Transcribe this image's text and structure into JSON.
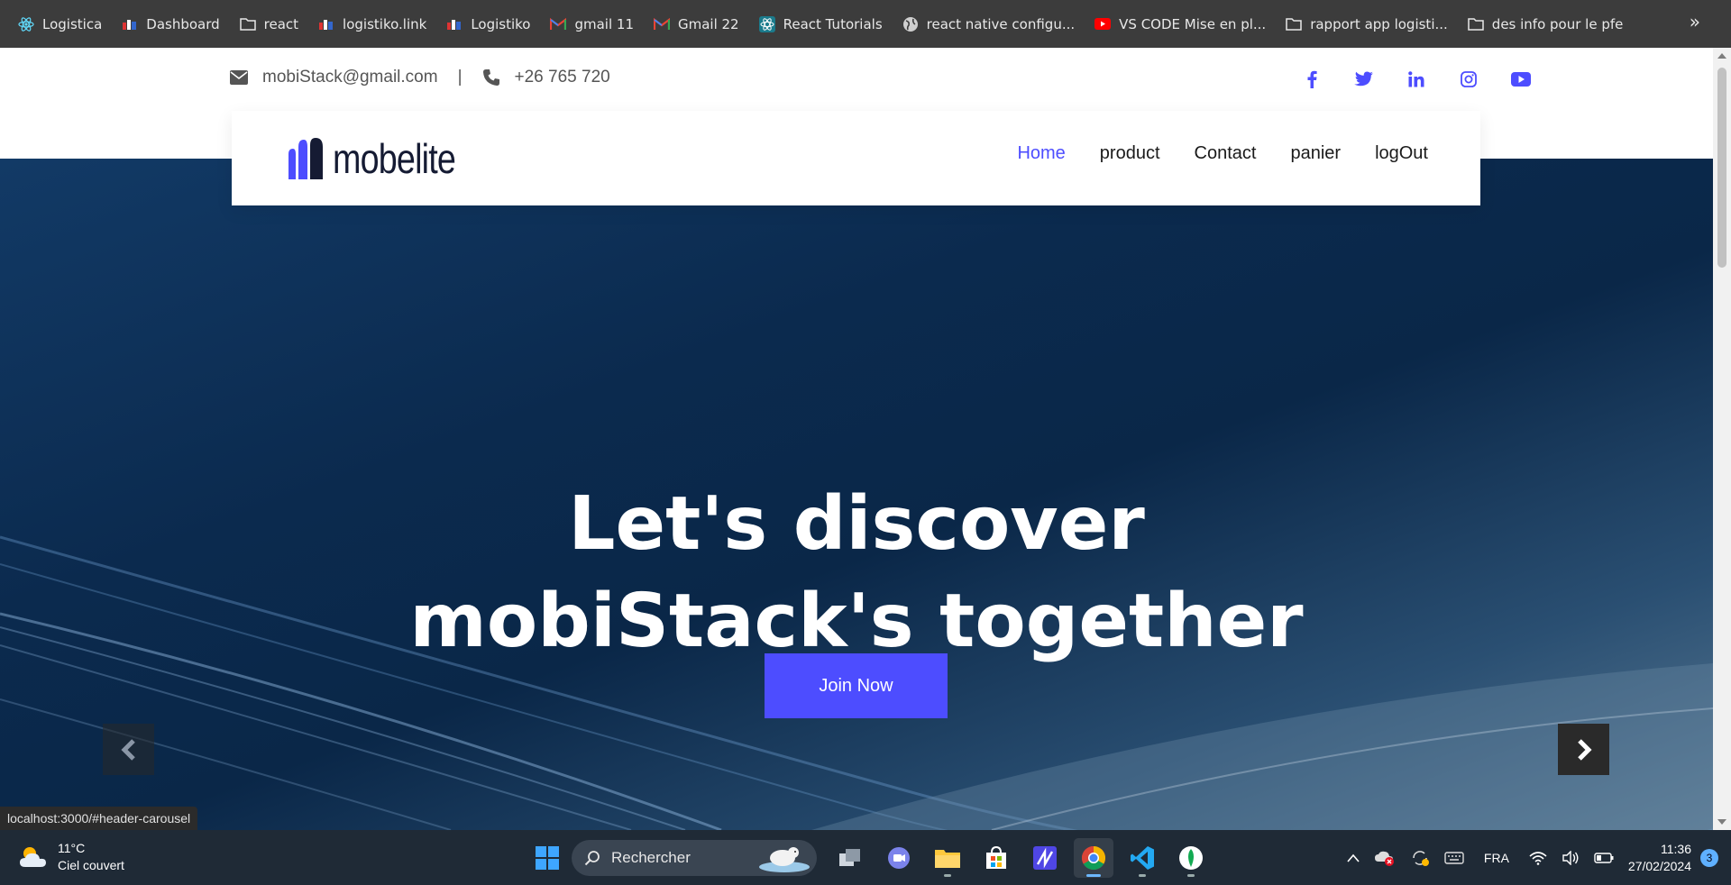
{
  "bookmarks": [
    {
      "label": "Logistica",
      "icon": "react-icon"
    },
    {
      "label": "Dashboard",
      "icon": "site-icon"
    },
    {
      "label": "react",
      "icon": "folder-icon"
    },
    {
      "label": "logistiko.link",
      "icon": "site-icon"
    },
    {
      "label": "Logistiko",
      "icon": "site-icon"
    },
    {
      "label": "gmail 11",
      "icon": "gmail-icon"
    },
    {
      "label": "Gmail 22",
      "icon": "gmail-icon"
    },
    {
      "label": "React Tutorials",
      "icon": "react-icon"
    },
    {
      "label": "react native configu...",
      "icon": "globe-icon"
    },
    {
      "label": "VS CODE Mise en pl...",
      "icon": "youtube-icon"
    },
    {
      "label": "rapport app logisti...",
      "icon": "folder-icon"
    },
    {
      "label": "des info pour le pfe",
      "icon": "folder-icon"
    }
  ],
  "topbar": {
    "email": "mobiStack@gmail.com",
    "separator": "|",
    "phone": "+26 765 720",
    "socials": [
      "facebook-icon",
      "twitter-icon",
      "linkedin-icon",
      "instagram-icon",
      "youtube-icon"
    ],
    "social_color": "#4d4dff"
  },
  "navbar": {
    "logo_text": "mobelite",
    "links": [
      {
        "label": "Home",
        "active": true
      },
      {
        "label": "product",
        "active": false
      },
      {
        "label": "Contact",
        "active": false
      },
      {
        "label": "panier",
        "active": false
      },
      {
        "label": "logOut",
        "active": false
      }
    ],
    "accent": "#4d4dff"
  },
  "hero": {
    "headline_line1": "Let's discover",
    "headline_line2": "mobiStack's together",
    "cta_label": "Join Now"
  },
  "status_url": "localhost:3000/#header-carousel",
  "taskbar": {
    "weather_temp": "11°C",
    "weather_desc": "Ciel couvert",
    "search_placeholder": "Rechercher",
    "lang": "FRA",
    "time": "11:36",
    "date": "27/02/2024",
    "notifications": "3"
  }
}
